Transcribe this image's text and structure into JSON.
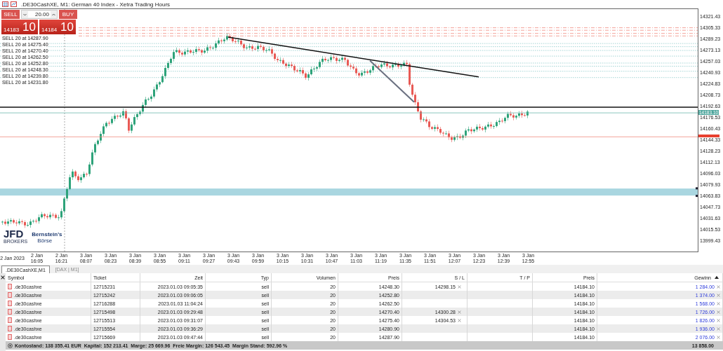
{
  "window": {
    "title": ".DE30CashXE, M1:  German 40 Index  - Xetra Trading Hours"
  },
  "trade_panel": {
    "sell_label": "SELL",
    "volume": "20.00",
    "buy_label": "BUY",
    "bid_main": "14183",
    "bid_big": "10",
    "ask_main": "14184",
    "ask_big": "10"
  },
  "orders": [
    {
      "label": "SELL 20 at 14287.90"
    },
    {
      "label": "SELL 20 at 14275.40"
    },
    {
      "label": "SELL 20 at 14270.40"
    },
    {
      "label": "SELL 20 at 14262.50"
    },
    {
      "label": "SELL 20 at 14252.80"
    },
    {
      "label": "SELL 20 at 14248.30"
    },
    {
      "label": "SELL 20 at 14239.80"
    },
    {
      "label": "SELL 20 at 14231.80"
    }
  ],
  "logo": {
    "brand": "JFD",
    "brand_sub": "BROKERS",
    "name_top": "Bernstein's",
    "name_bottom": "Börse"
  },
  "price_axis": {
    "labels": [
      "14321.43",
      "14305.33",
      "14289.23",
      "14273.13",
      "14257.03",
      "14240.93",
      "14224.83",
      "14208.73",
      "14192.63",
      "14176.53",
      "14160.43",
      "14144.33",
      "14128.23",
      "14112.13",
      "14096.03",
      "14079.93",
      "14063.83",
      "14047.73",
      "14031.63",
      "14015.53",
      "13999.43"
    ],
    "current_price": "14183.10"
  },
  "time_axis": {
    "labels": [
      "2 Jan 2023",
      "2 Jan 16:05",
      "2 Jan 16:21",
      "3 Jan 08:07",
      "3 Jan 08:23",
      "3 Jan 08:39",
      "3 Jan 08:55",
      "3 Jan 09:11",
      "3 Jan 09:27",
      "3 Jan 09:43",
      "3 Jan 09:59",
      "3 Jan 10:15",
      "3 Jan 10:31",
      "3 Jan 10:47",
      "3 Jan 11:03",
      "3 Jan 11:19",
      "3 Jan 11:35",
      "3 Jan 11:51",
      "3 Jan 12:07",
      "3 Jan 12:23",
      "3 Jan 12:39",
      "3 Jan 12:55"
    ]
  },
  "chart_tabs": [
    {
      "label": ".DE30CashXE,M1",
      "selected": true
    },
    {
      "label": "[DAX | M1]",
      "selected": false
    }
  ],
  "table": {
    "columns": [
      "Symbol",
      "Ticket",
      "Zeit",
      "Typ",
      "Volumen",
      "Preis",
      "S / L",
      "T / P",
      "Preis",
      "Gewinn"
    ],
    "rows": [
      {
        "symbol": ".de30cashxe",
        "ticket": "12715231",
        "time": "2023.01.03 09:05:35",
        "type": "sell",
        "volume": "20",
        "price": "14248.30",
        "sl": "14298.15",
        "tp": "",
        "current": "14184.10",
        "profit": "1 284.00"
      },
      {
        "symbol": ".de30cashxe",
        "ticket": "12715242",
        "time": "2023.01.03 09:06:05",
        "type": "sell",
        "volume": "20",
        "price": "14252.80",
        "sl": "",
        "tp": "",
        "current": "14184.10",
        "profit": "1 374.00"
      },
      {
        "symbol": ".de30cashxe",
        "ticket": "12716288",
        "time": "2023.01.03 11:04:24",
        "type": "sell",
        "volume": "20",
        "price": "14262.50",
        "sl": "",
        "tp": "",
        "current": "14184.10",
        "profit": "1 568.00"
      },
      {
        "symbol": ".de30cashxe",
        "ticket": "12715498",
        "time": "2023.01.03 09:29:48",
        "type": "sell",
        "volume": "20",
        "price": "14270.40",
        "sl": "14300.28",
        "tp": "",
        "current": "14184.10",
        "profit": "1 726.00"
      },
      {
        "symbol": ".de30cashxe",
        "ticket": "12715513",
        "time": "2023.01.03 09:31:07",
        "type": "sell",
        "volume": "20",
        "price": "14275.40",
        "sl": "14304.53",
        "tp": "",
        "current": "14184.10",
        "profit": "1 826.00"
      },
      {
        "symbol": ".de30cashxe",
        "ticket": "12715554",
        "time": "2023.01.03 09:36:29",
        "type": "sell",
        "volume": "20",
        "price": "14280.90",
        "sl": "",
        "tp": "",
        "current": "14184.10",
        "profit": "1 936.00"
      },
      {
        "symbol": ".de30cashxe",
        "ticket": "12715669",
        "time": "2023.01.03 09:47:44",
        "type": "sell",
        "volume": "20",
        "price": "14287.90",
        "sl": "",
        "tp": "",
        "current": "14184.10",
        "profit": "2 076.00"
      }
    ]
  },
  "status_bar": {
    "text": "Kontostand: 138 355.41 EUR  Kapital: 152 213.41  Marge: 25 669.96  Freie Margin: 126 543.45  Margin Stand: 592.96 %",
    "total": "13 858.00"
  }
}
